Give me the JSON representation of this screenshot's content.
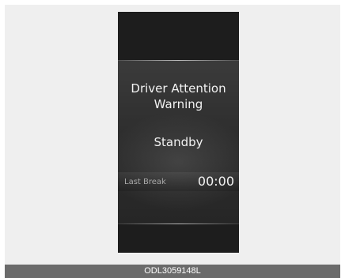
{
  "display": {
    "title_line1": "Driver Attention",
    "title_line2": "Warning",
    "status": "Standby",
    "last_break_label": "Last Break",
    "last_break_value": "00:00"
  },
  "caption": "ODL3059148L"
}
